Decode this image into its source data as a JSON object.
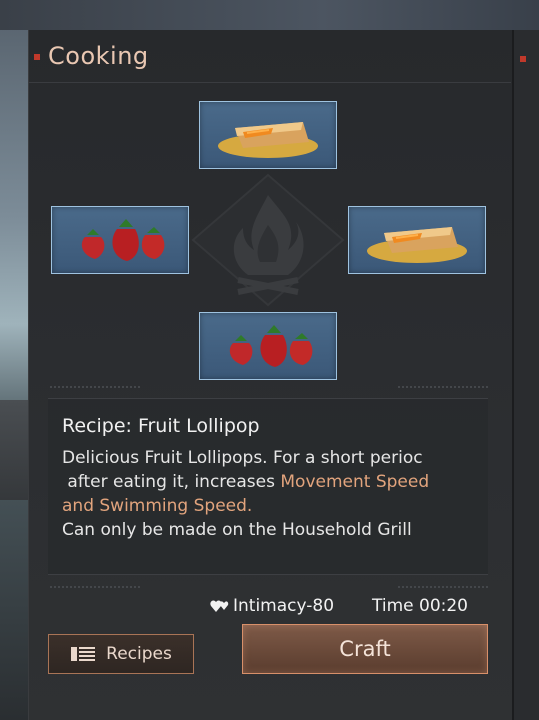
{
  "panel": {
    "title": "Cooking"
  },
  "ingredients": {
    "top": {
      "icon": "honey-toast-icon"
    },
    "left": {
      "icon": "strawberries-icon"
    },
    "right": {
      "icon": "honey-toast-icon"
    },
    "bottom": {
      "icon": "strawberries-icon"
    }
  },
  "center_icon": "campfire-icon",
  "recipe": {
    "title": "Recipe: Fruit Lollipop",
    "desc_line1": "Delicious Fruit Lollipops. For a short perioc",
    "desc_line2_a": " after eating it, increases ",
    "desc_line2_b": "Movement Speed",
    "desc_line3": "and Swimming Speed.",
    "desc_line4": "Can only be made on the Household Grill"
  },
  "stats": {
    "intimacy": "Intimacy-80",
    "time": "Time 00:20"
  },
  "buttons": {
    "recipes": "Recipes",
    "craft": "Craft"
  },
  "colors": {
    "accent": "#e2a47d",
    "slot_bg": "#4a6a8a",
    "slot_border": "#9fc3e0",
    "craft_bg": "#684838"
  }
}
